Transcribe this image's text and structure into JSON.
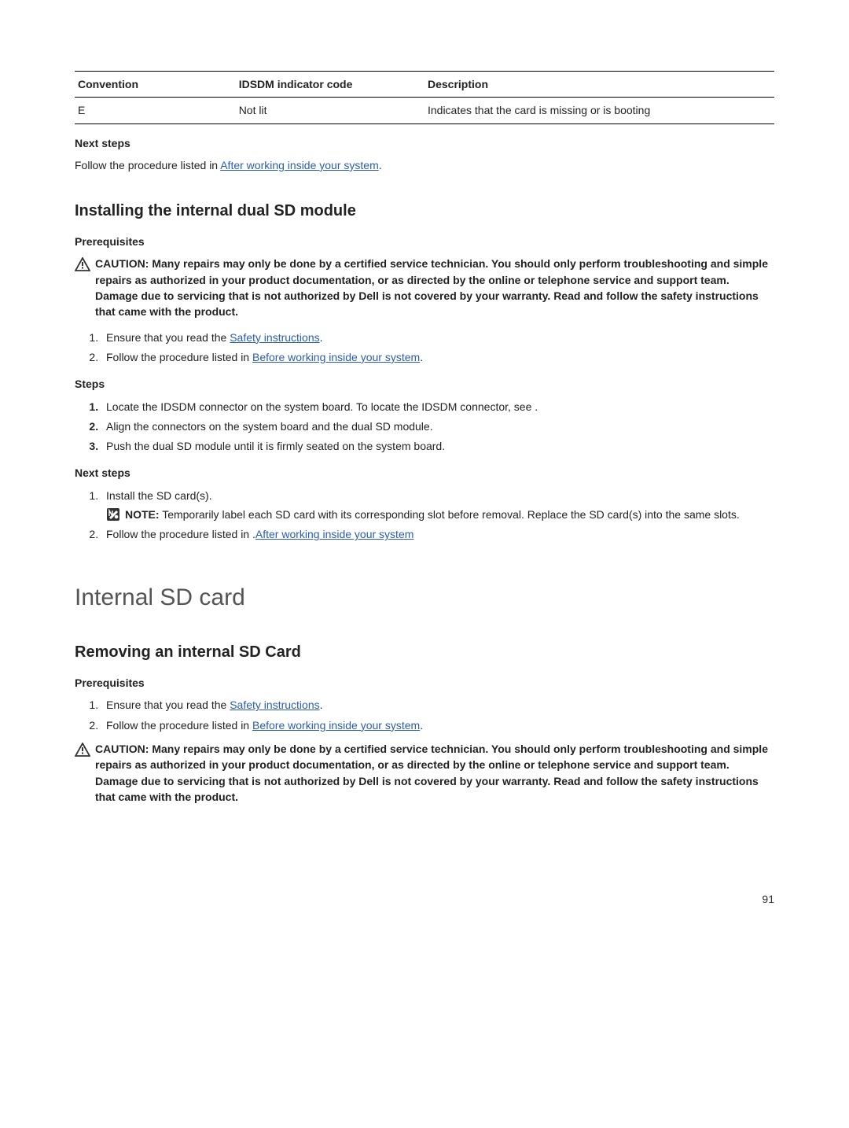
{
  "table": {
    "headers": {
      "c0": "Convention",
      "c1": "IDSDM indicator code",
      "c2": "Description"
    },
    "row": {
      "c0": "E",
      "c1": "Not lit",
      "c2": "Indicates that the card is missing or is booting"
    }
  },
  "top_next_steps": {
    "heading": "Next steps",
    "line_pre": "Follow the procedure listed in ",
    "line_link": "After working inside your system",
    "line_post": "."
  },
  "install": {
    "heading": "Installing the internal dual SD module",
    "prereq_heading": "Prerequisites",
    "caution": "Many repairs may only be done by a certified service technician. You should only perform troubleshooting and simple repairs as authorized in your product documentation, or as directed by the online or telephone service and support team. Damage due to servicing that is not authorized by Dell is not covered by your warranty. Read and follow the safety instructions that came with the product.",
    "prereq_items": {
      "i1_pre": "Ensure that you read the ",
      "i1_link": "Safety instructions",
      "i1_post": ".",
      "i2_pre": "Follow the procedure listed in ",
      "i2_link": "Before working inside your system",
      "i2_post": "."
    },
    "steps_heading": "Steps",
    "steps": {
      "s1": "Locate the IDSDM connector on the system board. To locate the IDSDM connector, see .",
      "s2": "Align the connectors on the system board and the dual SD module.",
      "s3": "Push the dual SD module until it is firmly seated on the system board."
    },
    "next_heading": "Next steps",
    "next_items": {
      "n1": "Install the SD card(s).",
      "note_label": "NOTE:",
      "note_body": " Temporarily label each SD card with its corresponding slot before removal. Replace the SD card(s) into the same slots.",
      "n2_pre": "Follow the procedure listed in .",
      "n2_link": "After working inside your system"
    }
  },
  "internal_sd": {
    "heading": "Internal SD card",
    "sub_heading": "Removing an internal SD Card",
    "prereq_heading": "Prerequisites",
    "prereq_items": {
      "i1_pre": "Ensure that you read the ",
      "i1_link": "Safety instructions",
      "i1_post": ".",
      "i2_pre": "Follow the procedure listed in ",
      "i2_link": "Before working inside your system",
      "i2_post": "."
    },
    "caution": "Many repairs may only be done by a certified service technician. You should only perform troubleshooting and simple repairs as authorized in your product documentation, or as directed by the online or telephone service and support team. Damage due to servicing that is not authorized by Dell is not covered by your warranty. Read and follow the safety instructions that came with the product."
  },
  "labels": {
    "caution": "CAUTION: "
  },
  "page_number": "91"
}
